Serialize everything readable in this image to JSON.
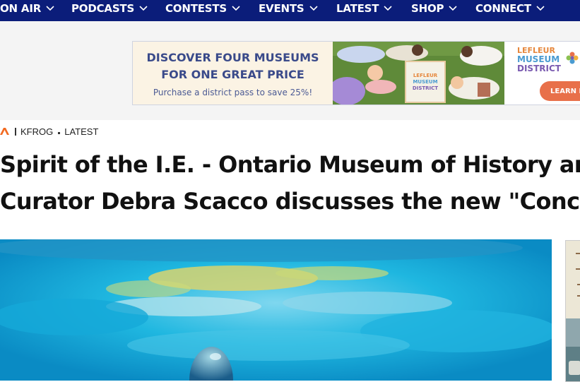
{
  "nav": {
    "items": [
      {
        "label": "ON AIR"
      },
      {
        "label": "PODCASTS"
      },
      {
        "label": "CONTESTS"
      },
      {
        "label": "EVENTS"
      },
      {
        "label": "LATEST"
      },
      {
        "label": "SHOP"
      },
      {
        "label": "CONNECT"
      }
    ],
    "bg_color": "#0b1d7a"
  },
  "ad": {
    "line1": "DISCOVER FOUR MUSEUMS",
    "line2": "FOR ONE GREAT PRICE",
    "line3": "Purchase a district pass to save 25%!",
    "logo_line1": "LEFLEUR",
    "logo_line2": "MUSEUM",
    "logo_line3": "DISTRICT",
    "cta": "LEARN M",
    "photo_sign_line1": "LEFLEUR",
    "photo_sign_line2": "MUSEUM",
    "photo_sign_line3": "DISTRICT"
  },
  "breadcrumb": {
    "items": [
      "KFROG",
      "LATEST"
    ],
    "logo_color": "#f26a21"
  },
  "article": {
    "title_line1": "Spirit of the I.E. - Ontario Museum of History an",
    "title_line2": "Curator Debra Scacco discusses the new \"Conc"
  }
}
